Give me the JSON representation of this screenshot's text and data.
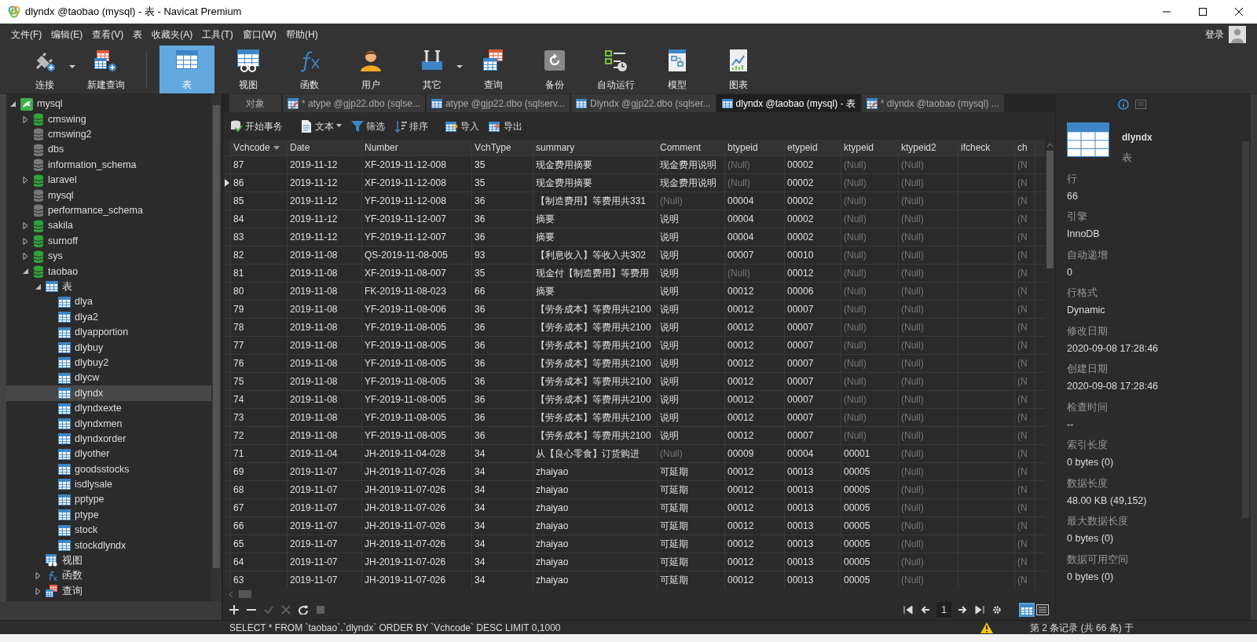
{
  "window": {
    "title": "dlyndx @taobao (mysql) - 表 - Navicat Premium"
  },
  "menu": [
    "文件(F)",
    "编辑(E)",
    "查看(V)",
    "表",
    "收藏夹(A)",
    "工具(T)",
    "窗口(W)",
    "帮助(H)"
  ],
  "login": "登录",
  "toolbar": [
    {
      "label": "连接",
      "selected": false,
      "dropdown": true
    },
    {
      "label": "新建查询",
      "selected": false,
      "dropdown": false
    },
    {
      "label": "表",
      "selected": true,
      "dropdown": false
    },
    {
      "label": "视图",
      "selected": false,
      "dropdown": false
    },
    {
      "label": "函数",
      "selected": false,
      "dropdown": false
    },
    {
      "label": "用户",
      "selected": false,
      "dropdown": false
    },
    {
      "label": "其它",
      "selected": false,
      "dropdown": true
    },
    {
      "label": "查询",
      "selected": false,
      "dropdown": false
    },
    {
      "label": "备份",
      "selected": false,
      "dropdown": false
    },
    {
      "label": "自动运行",
      "selected": false,
      "dropdown": false
    },
    {
      "label": "模型",
      "selected": false,
      "dropdown": false
    },
    {
      "label": "图表",
      "selected": false,
      "dropdown": false
    }
  ],
  "tree": [
    {
      "label": "mysql",
      "kind": "connection",
      "expanded": true,
      "selected": false,
      "children": [
        {
          "label": "cmswing",
          "kind": "database",
          "connected": true,
          "expanded": false,
          "selected": false
        },
        {
          "label": "cmswing2",
          "kind": "database",
          "connected": false,
          "selected": false
        },
        {
          "label": "dbs",
          "kind": "database",
          "connected": false,
          "selected": false
        },
        {
          "label": "information_schema",
          "kind": "database",
          "connected": false,
          "selected": false
        },
        {
          "label": "laravel",
          "kind": "database",
          "connected": true,
          "expanded": false,
          "selected": false
        },
        {
          "label": "mysql",
          "kind": "database",
          "connected": false,
          "selected": false
        },
        {
          "label": "performance_schema",
          "kind": "database",
          "connected": false,
          "selected": false
        },
        {
          "label": "sakila",
          "kind": "database",
          "connected": true,
          "expanded": false,
          "selected": false
        },
        {
          "label": "surnoff",
          "kind": "database",
          "connected": true,
          "expanded": false,
          "selected": false
        },
        {
          "label": "sys",
          "kind": "database",
          "connected": true,
          "expanded": false,
          "selected": false
        },
        {
          "label": "taobao",
          "kind": "database",
          "connected": true,
          "expanded": true,
          "selected": false,
          "children": [
            {
              "label": "表",
              "kind": "tables",
              "expanded": true,
              "selected": false,
              "children": [
                {
                  "label": "dlya",
                  "kind": "table",
                  "selected": false
                },
                {
                  "label": "dlya2",
                  "kind": "table",
                  "selected": false
                },
                {
                  "label": "dlyapportion",
                  "kind": "table",
                  "selected": false
                },
                {
                  "label": "dlybuy",
                  "kind": "table",
                  "selected": false
                },
                {
                  "label": "dlybuy2",
                  "kind": "table",
                  "selected": false
                },
                {
                  "label": "dlycw",
                  "kind": "table",
                  "selected": false
                },
                {
                  "label": "dlyndx",
                  "kind": "table",
                  "selected": true
                },
                {
                  "label": "dlyndxexte",
                  "kind": "table",
                  "selected": false
                },
                {
                  "label": "dlyndxmen",
                  "kind": "table",
                  "selected": false
                },
                {
                  "label": "dlyndxorder",
                  "kind": "table",
                  "selected": false
                },
                {
                  "label": "dlyother",
                  "kind": "table",
                  "selected": false
                },
                {
                  "label": "goodsstocks",
                  "kind": "table",
                  "selected": false
                },
                {
                  "label": "isdlysale",
                  "kind": "table",
                  "selected": false
                },
                {
                  "label": "pptype",
                  "kind": "table",
                  "selected": false
                },
                {
                  "label": "ptype",
                  "kind": "table",
                  "selected": false
                },
                {
                  "label": "stock",
                  "kind": "table",
                  "selected": false
                },
                {
                  "label": "stockdlyndx",
                  "kind": "table",
                  "selected": false
                }
              ]
            },
            {
              "label": "视图",
              "kind": "views",
              "selected": false
            },
            {
              "label": "函数",
              "kind": "functions",
              "expanded": false,
              "selected": false
            },
            {
              "label": "查询",
              "kind": "queries",
              "expanded": false,
              "selected": false
            }
          ]
        }
      ]
    }
  ],
  "tabs": [
    {
      "label": "对象",
      "kind": "plain",
      "selected": false
    },
    {
      "label": "* atype @gjp22.dbo (sqlse...",
      "kind": "modified",
      "selected": false
    },
    {
      "label": "atype @gjp22.dbo (sqlserv...",
      "kind": "table",
      "selected": false
    },
    {
      "label": "Dlyndx @gjp22.dbo (sqlser...",
      "kind": "table",
      "selected": false
    },
    {
      "label": "dlyndx @taobao (mysql) - 表",
      "kind": "table",
      "selected": true
    },
    {
      "label": "* dlyndx @taobao (mysql) ...",
      "kind": "modified",
      "selected": false
    }
  ],
  "actions": [
    {
      "label": "开始事务",
      "dropdown": false
    },
    {
      "label": "文本",
      "dropdown": true
    },
    {
      "label": "筛选",
      "dropdown": false
    },
    {
      "label": "排序",
      "dropdown": false
    },
    {
      "label": "导入",
      "dropdown": false
    },
    {
      "label": "导出",
      "dropdown": false
    }
  ],
  "table": {
    "columns": [
      {
        "label": "Vchcode",
        "sorted_descending": true
      },
      {
        "label": "Date",
        "sorted_descending": false
      },
      {
        "label": "Number",
        "sorted_descending": false
      },
      {
        "label": "VchType",
        "sorted_descending": false
      },
      {
        "label": "summary",
        "sorted_descending": false
      },
      {
        "label": "Comment",
        "sorted_descending": false
      },
      {
        "label": "btypeid",
        "sorted_descending": false
      },
      {
        "label": "etypeid",
        "sorted_descending": false
      },
      {
        "label": "ktypeid",
        "sorted_descending": false
      },
      {
        "label": "ktypeid2",
        "sorted_descending": false
      },
      {
        "label": "ifcheck",
        "sorted_descending": false
      },
      {
        "label": "ch",
        "sorted_descending": false
      }
    ],
    "rows": [
      {
        "current": false,
        "cells": [
          "87",
          "2019-11-12",
          "XF-2019-11-12-008",
          "35",
          "现金费用摘要",
          "现金费用说明",
          {
            "text": "(Null)",
            "null": true
          },
          "00002",
          {
            "text": "(Null)",
            "null": true
          },
          {
            "text": "(Null)",
            "null": true
          },
          null,
          {
            "text": "(N",
            "null": true
          }
        ]
      },
      {
        "current": true,
        "cells": [
          "86",
          "2019-11-12",
          "XF-2019-11-12-008",
          "35",
          "现金费用摘要",
          "现金费用说明",
          {
            "text": "(Null)",
            "null": true
          },
          "00002",
          {
            "text": "(Null)",
            "null": true
          },
          {
            "text": "(Null)",
            "null": true
          },
          null,
          {
            "text": "(N",
            "null": true
          }
        ]
      },
      {
        "current": false,
        "cells": [
          "85",
          "2019-11-12",
          "YF-2019-11-12-008",
          "36",
          "【制造费用】等费用共331",
          {
            "text": "(Null)",
            "null": true
          },
          "00004",
          "00002",
          {
            "text": "(Null)",
            "null": true
          },
          {
            "text": "(Null)",
            "null": true
          },
          null,
          {
            "text": "(N",
            "null": true
          }
        ]
      },
      {
        "current": false,
        "cells": [
          "84",
          "2019-11-12",
          "YF-2019-11-12-007",
          "36",
          "摘要",
          "说明",
          "00004",
          "00002",
          {
            "text": "(Null)",
            "null": true
          },
          {
            "text": "(Null)",
            "null": true
          },
          null,
          {
            "text": "(N",
            "null": true
          }
        ]
      },
      {
        "current": false,
        "cells": [
          "83",
          "2019-11-12",
          "YF-2019-11-12-007",
          "36",
          "摘要",
          "说明",
          "00004",
          "00002",
          {
            "text": "(Null)",
            "null": true
          },
          {
            "text": "(Null)",
            "null": true
          },
          null,
          {
            "text": "(N",
            "null": true
          }
        ]
      },
      {
        "current": false,
        "cells": [
          "82",
          "2019-11-08",
          "QS-2019-11-08-005",
          "93",
          "【利息收入】等收入共302",
          "说明",
          "00007",
          "00010",
          {
            "text": "(Null)",
            "null": true
          },
          {
            "text": "(Null)",
            "null": true
          },
          null,
          {
            "text": "(N",
            "null": true
          }
        ]
      },
      {
        "current": false,
        "cells": [
          "81",
          "2019-11-08",
          "XF-2019-11-08-007",
          "35",
          "现金付【制造费用】等费用",
          "说明",
          {
            "text": "(Null)",
            "null": true
          },
          "00012",
          {
            "text": "(Null)",
            "null": true
          },
          {
            "text": "(Null)",
            "null": true
          },
          null,
          {
            "text": "(N",
            "null": true
          }
        ]
      },
      {
        "current": false,
        "cells": [
          "80",
          "2019-11-08",
          "FK-2019-11-08-023",
          "66",
          "摘要",
          "说明",
          "00012",
          "00006",
          {
            "text": "(Null)",
            "null": true
          },
          {
            "text": "(Null)",
            "null": true
          },
          null,
          {
            "text": "(N",
            "null": true
          }
        ]
      },
      {
        "current": false,
        "cells": [
          "79",
          "2019-11-08",
          "YF-2019-11-08-006",
          "36",
          "【劳务成本】等费用共2100",
          "说明",
          "00012",
          "00007",
          {
            "text": "(Null)",
            "null": true
          },
          {
            "text": "(Null)",
            "null": true
          },
          null,
          {
            "text": "(N",
            "null": true
          }
        ]
      },
      {
        "current": false,
        "cells": [
          "78",
          "2019-11-08",
          "YF-2019-11-08-005",
          "36",
          "【劳务成本】等费用共2100",
          "说明",
          "00012",
          "00007",
          {
            "text": "(Null)",
            "null": true
          },
          {
            "text": "(Null)",
            "null": true
          },
          null,
          {
            "text": "(N",
            "null": true
          }
        ]
      },
      {
        "current": false,
        "cells": [
          "77",
          "2019-11-08",
          "YF-2019-11-08-005",
          "36",
          "【劳务成本】等费用共2100",
          "说明",
          "00012",
          "00007",
          {
            "text": "(Null)",
            "null": true
          },
          {
            "text": "(Null)",
            "null": true
          },
          null,
          {
            "text": "(N",
            "null": true
          }
        ]
      },
      {
        "current": false,
        "cells": [
          "76",
          "2019-11-08",
          "YF-2019-11-08-005",
          "36",
          "【劳务成本】等费用共2100",
          "说明",
          "00012",
          "00007",
          {
            "text": "(Null)",
            "null": true
          },
          {
            "text": "(Null)",
            "null": true
          },
          null,
          {
            "text": "(N",
            "null": true
          }
        ]
      },
      {
        "current": false,
        "cells": [
          "75",
          "2019-11-08",
          "YF-2019-11-08-005",
          "36",
          "【劳务成本】等费用共2100",
          "说明",
          "00012",
          "00007",
          {
            "text": "(Null)",
            "null": true
          },
          {
            "text": "(Null)",
            "null": true
          },
          null,
          {
            "text": "(N",
            "null": true
          }
        ]
      },
      {
        "current": false,
        "cells": [
          "74",
          "2019-11-08",
          "YF-2019-11-08-005",
          "36",
          "【劳务成本】等费用共2100",
          "说明",
          "00012",
          "00007",
          {
            "text": "(Null)",
            "null": true
          },
          {
            "text": "(Null)",
            "null": true
          },
          null,
          {
            "text": "(N",
            "null": true
          }
        ]
      },
      {
        "current": false,
        "cells": [
          "73",
          "2019-11-08",
          "YF-2019-11-08-005",
          "36",
          "【劳务成本】等费用共2100",
          "说明",
          "00012",
          "00007",
          {
            "text": "(Null)",
            "null": true
          },
          {
            "text": "(Null)",
            "null": true
          },
          null,
          {
            "text": "(N",
            "null": true
          }
        ]
      },
      {
        "current": false,
        "cells": [
          "72",
          "2019-11-08",
          "YF-2019-11-08-005",
          "36",
          "【劳务成本】等费用共2100",
          "说明",
          "00012",
          "00007",
          {
            "text": "(Null)",
            "null": true
          },
          {
            "text": "(Null)",
            "null": true
          },
          null,
          {
            "text": "(N",
            "null": true
          }
        ]
      },
      {
        "current": false,
        "cells": [
          "71",
          "2019-11-04",
          "JH-2019-11-04-028",
          "34",
          "从【良心零食】订货购进",
          {
            "text": "(Null)",
            "null": true
          },
          "00009",
          "00004",
          "00001",
          {
            "text": "(Null)",
            "null": true
          },
          null,
          {
            "text": "(N",
            "null": true
          }
        ]
      },
      {
        "current": false,
        "cells": [
          "69",
          "2019-11-07",
          "JH-2019-11-07-026",
          "34",
          "zhaiyao",
          "可延期",
          "00012",
          "00013",
          "00005",
          {
            "text": "(Null)",
            "null": true
          },
          null,
          {
            "text": "(N",
            "null": true
          }
        ]
      },
      {
        "current": false,
        "cells": [
          "68",
          "2019-11-07",
          "JH-2019-11-07-026",
          "34",
          "zhaiyao",
          "可延期",
          "00012",
          "00013",
          "00005",
          {
            "text": "(Null)",
            "null": true
          },
          null,
          {
            "text": "(N",
            "null": true
          }
        ]
      },
      {
        "current": false,
        "cells": [
          "67",
          "2019-11-07",
          "JH-2019-11-07-026",
          "34",
          "zhaiyao",
          "可延期",
          "00012",
          "00013",
          "00005",
          {
            "text": "(Null)",
            "null": true
          },
          null,
          {
            "text": "(N",
            "null": true
          }
        ]
      },
      {
        "current": false,
        "cells": [
          "66",
          "2019-11-07",
          "JH-2019-11-07-026",
          "34",
          "zhaiyao",
          "可延期",
          "00012",
          "00013",
          "00005",
          {
            "text": "(Null)",
            "null": true
          },
          null,
          {
            "text": "(N",
            "null": true
          }
        ]
      },
      {
        "current": false,
        "cells": [
          "65",
          "2019-11-07",
          "JH-2019-11-07-026",
          "34",
          "zhaiyao",
          "可延期",
          "00012",
          "00013",
          "00005",
          {
            "text": "(Null)",
            "null": true
          },
          null,
          {
            "text": "(N",
            "null": true
          }
        ]
      },
      {
        "current": false,
        "cells": [
          "64",
          "2019-11-07",
          "JH-2019-11-07-026",
          "34",
          "zhaiyao",
          "可延期",
          "00012",
          "00013",
          "00005",
          {
            "text": "(Null)",
            "null": true
          },
          null,
          {
            "text": "(N",
            "null": true
          }
        ]
      },
      {
        "current": false,
        "cells": [
          "63",
          "2019-11-07",
          "JH-2019-11-07-026",
          "34",
          "zhaiyao",
          "可延期",
          "00012",
          "00013",
          "00005",
          {
            "text": "(Null)",
            "null": true
          },
          null,
          {
            "text": "(N",
            "null": true
          }
        ]
      }
    ]
  },
  "edit_tools": [
    {
      "kind": "add",
      "disabled": false
    },
    {
      "kind": "remove",
      "disabled": false
    },
    {
      "kind": "apply",
      "disabled": true
    },
    {
      "kind": "cancel",
      "disabled": true
    },
    {
      "kind": "refresh",
      "disabled": false
    },
    {
      "kind": "stop",
      "disabled": true
    }
  ],
  "pager": {
    "page": "1"
  },
  "view_modes": [
    {
      "kind": "grid",
      "selected": true
    },
    {
      "kind": "form",
      "selected": false
    }
  ],
  "info": {
    "name": "dlyndx",
    "type": "表",
    "fields": [
      {
        "label": "行",
        "value": "66"
      },
      {
        "label": "引擎",
        "value": "InnoDB"
      },
      {
        "label": "自动递增",
        "value": "0"
      },
      {
        "label": "行格式",
        "value": "Dynamic"
      },
      {
        "label": "修改日期",
        "value": "2020-09-08 17:28:46"
      },
      {
        "label": "创建日期",
        "value": "2020-09-08 17:28:46"
      },
      {
        "label": "检查时间",
        "value": "--"
      },
      {
        "label": "索引长度",
        "value": "0 bytes (0)"
      },
      {
        "label": "数据长度",
        "value": "48.00 KB (49,152)"
      },
      {
        "label": "最大数据长度",
        "value": "0 bytes (0)"
      },
      {
        "label": "数据可用空间",
        "value": "0 bytes (0)"
      }
    ]
  },
  "status": {
    "sql": "SELECT * FROM `taobao`.`dlyndx` ORDER BY `Vchcode` DESC LIMIT 0,1000",
    "message": "第 2 条记录 (共 66 条) 于"
  }
}
